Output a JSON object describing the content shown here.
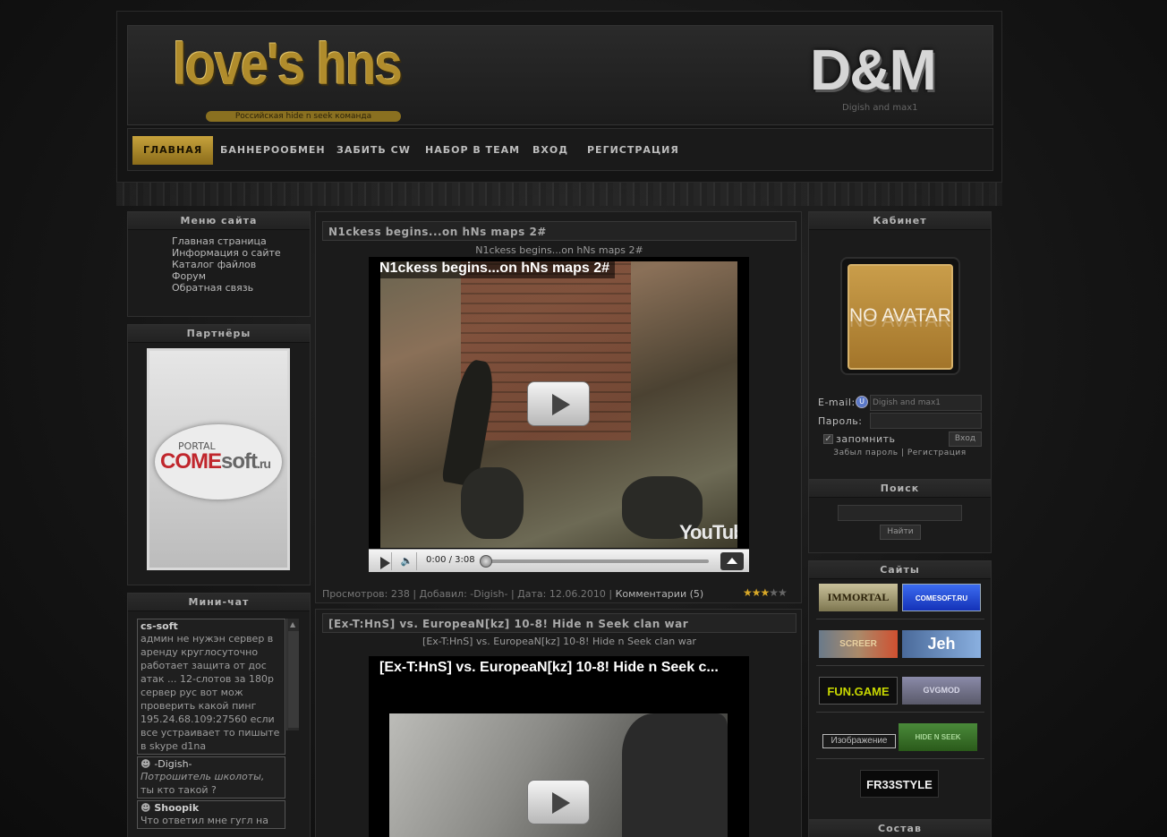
{
  "header": {
    "logo": "love's hns",
    "logo_subtitle": "Российская hide n seek команда",
    "brand": "D&M",
    "brand_subtitle": "Digish and max1"
  },
  "nav": {
    "items": [
      {
        "label": "ГЛАВНАЯ",
        "active": true
      },
      {
        "label": "БАННЕРООБМЕН"
      },
      {
        "label": "ЗАБИТЬ CW"
      },
      {
        "label": "НАБОР В TEAM"
      },
      {
        "label": "ВХОД"
      },
      {
        "label": "РЕГИСТРАЦИЯ"
      }
    ]
  },
  "left": {
    "menu": {
      "title": "Меню сайта",
      "items": [
        "Главная страница",
        "Информация о сайте",
        "Каталог файлов",
        "Форум",
        "Обратная связь"
      ]
    },
    "partners": {
      "title": "Партнёры",
      "banner_top": "PORTAL",
      "banner_red": "COME",
      "banner_grey": "soft",
      "banner_suffix": ".ru"
    },
    "chat": {
      "title": "Мини-чат",
      "messages": [
        {
          "user": "cs-soft",
          "text": "админ не нужэн сервер в аренду круглосуточно работает защита от дос атак ... 12-слотов за 180р сервер рус вот мож проверить какой пинг 195.24.68.109:27560 если все устраивает то пишыте в skype d1na"
        },
        {
          "user": "-Digish-",
          "text_italic": "Потрошитель школоты,",
          "text": "ты кто такой ?"
        },
        {
          "user": "Shoopik",
          "text": "Что ответил мне гугл на"
        }
      ]
    }
  },
  "posts": [
    {
      "title": "N1ckess begins...on hNs maps 2#",
      "subtitle": "N1ckess begins...on hNs maps 2#",
      "video_title": "N1ckess begins...on hNs maps 2#",
      "yt_logo": "YouTube",
      "time": "0:00 / 3:08",
      "meta": "Просмотров: 238 | Добавил: -Digish- | Дата: 12.06.2010 |",
      "comments": "Комментарии (5)",
      "rating": 3
    },
    {
      "title": "[Ex-T:HnS] vs. EuropeaN[kz] 10-8! Hide n Seek clan war",
      "subtitle": "[Ex-T:HnS] vs. EuropeaN[kz] 10-8! Hide n Seek clan war",
      "video_title": "[Ex-T:HnS] vs. EuropeaN[kz] 10-8! Hide n Seek c..."
    }
  ],
  "right": {
    "cabinet": {
      "title": "Кабинет",
      "avatar_text": "NO AVATAR",
      "email_label": "E-mail:",
      "email_value": "Digish and max1",
      "password_label": "Пароль:",
      "remember_label": "запомнить",
      "login_button": "Вход",
      "forgot_link": "Забыл пароль",
      "separator": "|",
      "register_link": "Регистрация"
    },
    "search": {
      "title": "Поиск",
      "button": "Найти"
    },
    "sites": {
      "title": "Сайты",
      "banners": [
        "IMMORTAL",
        "COMESOFT.RU",
        "SCREER",
        "Jeh",
        "FUN.GAME",
        "GVGMOD",
        "Изображение",
        "HIDE N SEEK",
        "FR33STYLE"
      ]
    },
    "roster": {
      "title": "Состав"
    }
  },
  "colors": {
    "accent": "#b08c2c",
    "background": "#161616",
    "panel": "#1b1b1b"
  }
}
